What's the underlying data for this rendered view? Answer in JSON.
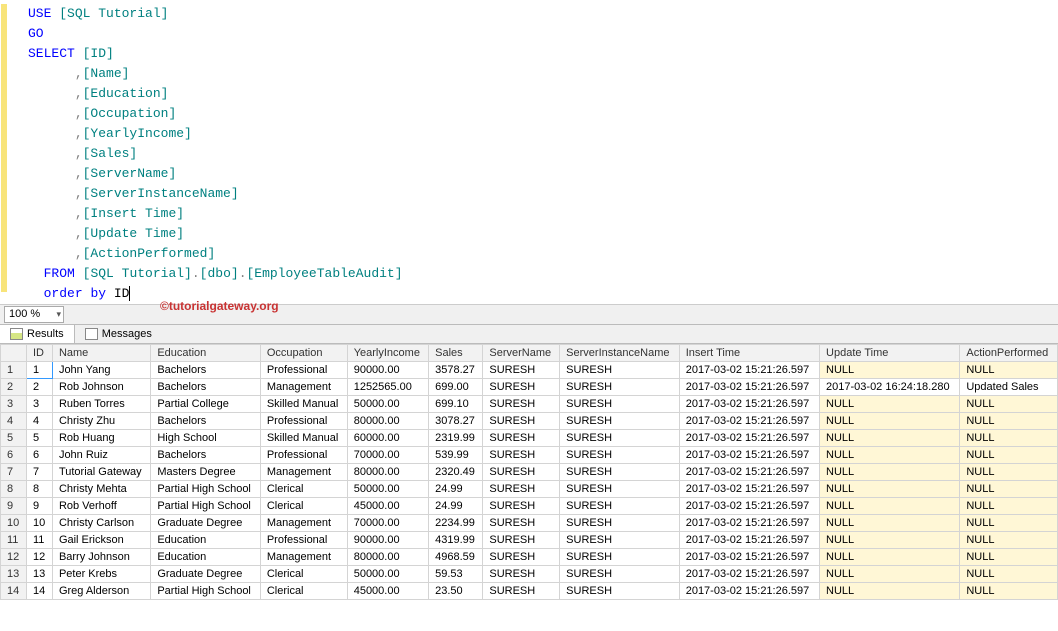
{
  "zoom": {
    "value": "100 %"
  },
  "watermark": "©tutorialgateway.org",
  "code": {
    "l1_use": "USE",
    "l1_db": "[SQL Tutorial]",
    "l2_go": "GO",
    "l3_sel": "SELECT",
    "l3_id": "[ID]",
    "l4": "[Name]",
    "l5": "[Education]",
    "l6": "[Occupation]",
    "l7": "[YearlyIncome]",
    "l8": "[Sales]",
    "l9": "[ServerName]",
    "l10": "[ServerInstanceName]",
    "l11": "[Insert Time]",
    "l12": "[Update Time]",
    "l13": "[ActionPerformed]",
    "l14_from": "FROM",
    "l14_a": "[SQL Tutorial]",
    "l14_b": "[dbo]",
    "l14_c": "[EmployeeTableAudit]",
    "l15_ord": "order",
    "l15_by": "by",
    "l15_id": "ID"
  },
  "tabs": {
    "results": "Results",
    "messages": "Messages"
  },
  "grid": {
    "headers": [
      "",
      "ID",
      "Name",
      "Education",
      "Occupation",
      "YearlyIncome",
      "Sales",
      "ServerName",
      "ServerInstanceName",
      "Insert Time",
      "Update Time",
      "ActionPerformed"
    ],
    "rows": [
      {
        "n": "1",
        "id": "1",
        "name": "John Yang",
        "edu": "Bachelors",
        "occ": "Professional",
        "inc": "90000.00",
        "sales": "3578.27",
        "srv": "SURESH",
        "inst": "SURESH",
        "ins": "2017-03-02 15:21:26.597",
        "upd": "NULL",
        "act": "NULL"
      },
      {
        "n": "2",
        "id": "2",
        "name": "Rob Johnson",
        "edu": "Bachelors",
        "occ": "Management",
        "inc": "1252565.00",
        "sales": "699.00",
        "srv": "SURESH",
        "inst": "SURESH",
        "ins": "2017-03-02 15:21:26.597",
        "upd": "2017-03-02 16:24:18.280",
        "act": "Updated Sales"
      },
      {
        "n": "3",
        "id": "3",
        "name": "Ruben Torres",
        "edu": "Partial College",
        "occ": "Skilled Manual",
        "inc": "50000.00",
        "sales": "699.10",
        "srv": "SURESH",
        "inst": "SURESH",
        "ins": "2017-03-02 15:21:26.597",
        "upd": "NULL",
        "act": "NULL"
      },
      {
        "n": "4",
        "id": "4",
        "name": "Christy Zhu",
        "edu": "Bachelors",
        "occ": "Professional",
        "inc": "80000.00",
        "sales": "3078.27",
        "srv": "SURESH",
        "inst": "SURESH",
        "ins": "2017-03-02 15:21:26.597",
        "upd": "NULL",
        "act": "NULL"
      },
      {
        "n": "5",
        "id": "5",
        "name": "Rob Huang",
        "edu": "High School",
        "occ": "Skilled Manual",
        "inc": "60000.00",
        "sales": "2319.99",
        "srv": "SURESH",
        "inst": "SURESH",
        "ins": "2017-03-02 15:21:26.597",
        "upd": "NULL",
        "act": "NULL"
      },
      {
        "n": "6",
        "id": "6",
        "name": "John Ruiz",
        "edu": "Bachelors",
        "occ": "Professional",
        "inc": "70000.00",
        "sales": "539.99",
        "srv": "SURESH",
        "inst": "SURESH",
        "ins": "2017-03-02 15:21:26.597",
        "upd": "NULL",
        "act": "NULL"
      },
      {
        "n": "7",
        "id": "7",
        "name": "Tutorial Gateway",
        "edu": "Masters Degree",
        "occ": "Management",
        "inc": "80000.00",
        "sales": "2320.49",
        "srv": "SURESH",
        "inst": "SURESH",
        "ins": "2017-03-02 15:21:26.597",
        "upd": "NULL",
        "act": "NULL"
      },
      {
        "n": "8",
        "id": "8",
        "name": "Christy Mehta",
        "edu": "Partial High School",
        "occ": "Clerical",
        "inc": "50000.00",
        "sales": "24.99",
        "srv": "SURESH",
        "inst": "SURESH",
        "ins": "2017-03-02 15:21:26.597",
        "upd": "NULL",
        "act": "NULL"
      },
      {
        "n": "9",
        "id": "9",
        "name": "Rob Verhoff",
        "edu": "Partial High School",
        "occ": "Clerical",
        "inc": "45000.00",
        "sales": "24.99",
        "srv": "SURESH",
        "inst": "SURESH",
        "ins": "2017-03-02 15:21:26.597",
        "upd": "NULL",
        "act": "NULL"
      },
      {
        "n": "10",
        "id": "10",
        "name": "Christy Carlson",
        "edu": "Graduate Degree",
        "occ": "Management",
        "inc": "70000.00",
        "sales": "2234.99",
        "srv": "SURESH",
        "inst": "SURESH",
        "ins": "2017-03-02 15:21:26.597",
        "upd": "NULL",
        "act": "NULL"
      },
      {
        "n": "11",
        "id": "11",
        "name": "Gail Erickson",
        "edu": "Education",
        "occ": "Professional",
        "inc": "90000.00",
        "sales": "4319.99",
        "srv": "SURESH",
        "inst": "SURESH",
        "ins": "2017-03-02 15:21:26.597",
        "upd": "NULL",
        "act": "NULL"
      },
      {
        "n": "12",
        "id": "12",
        "name": "Barry Johnson",
        "edu": "Education",
        "occ": "Management",
        "inc": "80000.00",
        "sales": "4968.59",
        "srv": "SURESH",
        "inst": "SURESH",
        "ins": "2017-03-02 15:21:26.597",
        "upd": "NULL",
        "act": "NULL"
      },
      {
        "n": "13",
        "id": "13",
        "name": "Peter Krebs",
        "edu": "Graduate Degree",
        "occ": "Clerical",
        "inc": "50000.00",
        "sales": "59.53",
        "srv": "SURESH",
        "inst": "SURESH",
        "ins": "2017-03-02 15:21:26.597",
        "upd": "NULL",
        "act": "NULL"
      },
      {
        "n": "14",
        "id": "14",
        "name": "Greg Alderson",
        "edu": "Partial High School",
        "occ": "Clerical",
        "inc": "45000.00",
        "sales": "23.50",
        "srv": "SURESH",
        "inst": "SURESH",
        "ins": "2017-03-02 15:21:26.597",
        "upd": "NULL",
        "act": "NULL"
      }
    ]
  }
}
